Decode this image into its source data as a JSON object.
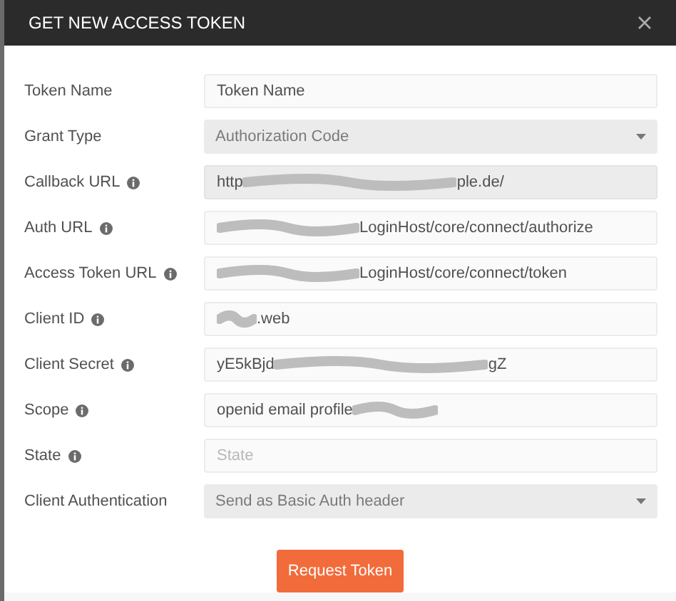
{
  "window": {
    "title": "GET NEW ACCESS TOKEN"
  },
  "fields": [
    {
      "label": "Token Name",
      "info": false,
      "kind": "input",
      "value": "Token Name"
    },
    {
      "label": "Grant Type",
      "info": false,
      "kind": "select",
      "value": "Authorization Code"
    },
    {
      "label": "Callback URL",
      "info": true,
      "kind": "readonly",
      "prefix": "http",
      "suffix": "ple.de/",
      "redacted": true
    },
    {
      "label": "Auth URL",
      "info": true,
      "kind": "input",
      "suffix": "LoginHost/core/connect/authorize",
      "redacted": true
    },
    {
      "label": "Access Token URL",
      "info": true,
      "kind": "input",
      "suffix": "LoginHost/core/connect/token",
      "redacted": true
    },
    {
      "label": "Client ID",
      "info": true,
      "kind": "input",
      "suffix": ".web",
      "redacted": true
    },
    {
      "label": "Client Secret",
      "info": true,
      "kind": "input",
      "prefix": "yE5kBjd",
      "suffix": "gZ",
      "redacted": true
    },
    {
      "label": "Scope",
      "info": true,
      "kind": "input",
      "prefix": "openid email profile",
      "redacted": true
    },
    {
      "label": "State",
      "info": true,
      "kind": "input",
      "placeholder": "State"
    },
    {
      "label": "Client Authentication",
      "info": false,
      "kind": "select",
      "value": "Send as Basic Auth header"
    }
  ],
  "buttons": [
    {
      "label": "Request Token"
    }
  ]
}
